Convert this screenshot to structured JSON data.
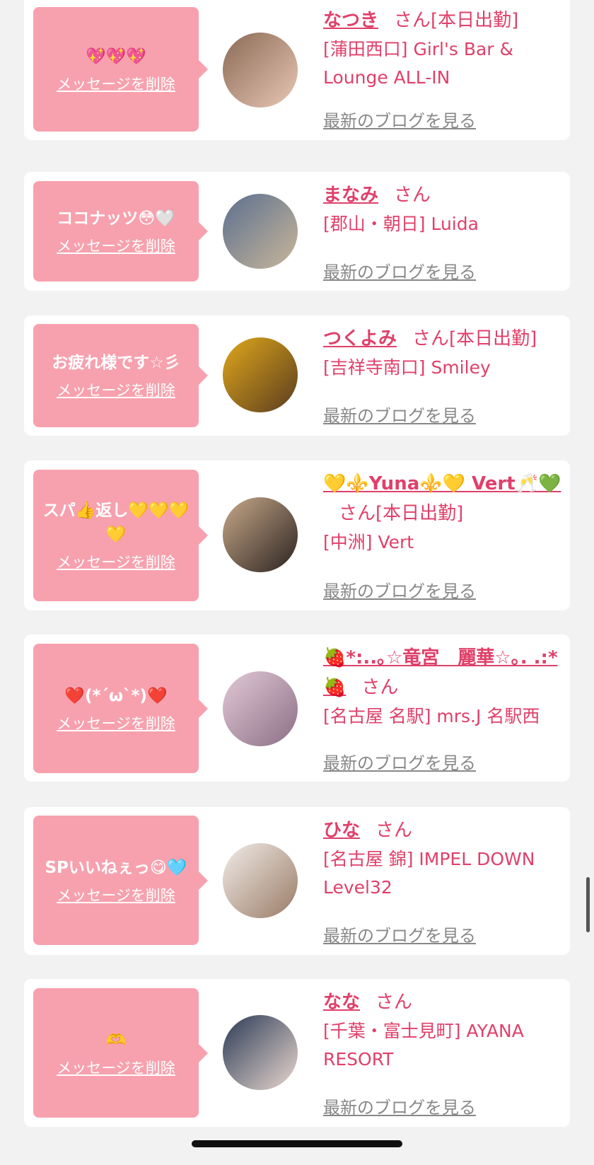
{
  "entries": [
    {
      "message": "💖💖💖",
      "delete_label": "メッセージを削除",
      "name": "なつき",
      "honorific": "さん",
      "status": "[本日出勤]",
      "shop": "[蒲田西口] Girl's Bar & Lounge ALL-IN",
      "blog_label": "最新のブログを見る",
      "avatar_colors": [
        "#8a6a55",
        "#e8c7b5"
      ]
    },
    {
      "message": "ココナッツ😳🤍",
      "delete_label": "メッセージを削除",
      "name": "まなみ",
      "honorific": "さん",
      "status": "",
      "shop": "[郡山・朝日] Luida",
      "blog_label": "最新のブログを見る",
      "avatar_colors": [
        "#5b6f8f",
        "#c9b79a"
      ]
    },
    {
      "message": "お疲れ様です☆彡",
      "delete_label": "メッセージを削除",
      "name": "つくよみ",
      "honorific": "さん",
      "status": "[本日出勤]",
      "shop": "[吉祥寺南口] Smiley",
      "blog_label": "最新のブログを見る",
      "avatar_colors": [
        "#e0a81c",
        "#5a3c1e"
      ]
    },
    {
      "message": "スパ👍返し💛💛💛💛",
      "delete_label": "メッセージを削除",
      "name": "💛⚜️Yuna⚜️💛 Vert🥂💚",
      "honorific": "さん",
      "status": "[本日出勤]",
      "shop": "[中洲] Vert",
      "blog_label": "最新のブログを見る",
      "avatar_colors": [
        "#c9a98a",
        "#2a2320"
      ]
    },
    {
      "message": "❤️(*´ω`*)❤️",
      "delete_label": "メッセージを削除",
      "name": "🍓*:..｡☆竜宮　麗華☆｡. .:*🍓",
      "honorific": "さん",
      "status": "",
      "shop": "[名古屋 名駅] mrs.J 名駅西",
      "blog_label": "最新のブログを見る",
      "avatar_colors": [
        "#e2c9d6",
        "#8b6f86"
      ]
    },
    {
      "message": "SPいいねぇっ😋🩵",
      "delete_label": "メッセージを削除",
      "name": "ひな",
      "honorific": "さん",
      "status": "",
      "shop": "[名古屋 錦] IMPEL DOWN Level32",
      "blog_label": "最新のブログを見る",
      "avatar_colors": [
        "#f1ece8",
        "#9a7b66"
      ]
    },
    {
      "message": "🫶",
      "delete_label": "メッセージを削除",
      "name": "なな",
      "honorific": "さん",
      "status": "",
      "shop": "[千葉・富士見町] AYANA RESORT",
      "blog_label": "最新のブログを見る",
      "avatar_colors": [
        "#2b3a55",
        "#e9d8cf"
      ]
    }
  ],
  "colors": {
    "accent": "#e0406a",
    "bubble": "#f7a1ae",
    "muted": "#888888"
  }
}
